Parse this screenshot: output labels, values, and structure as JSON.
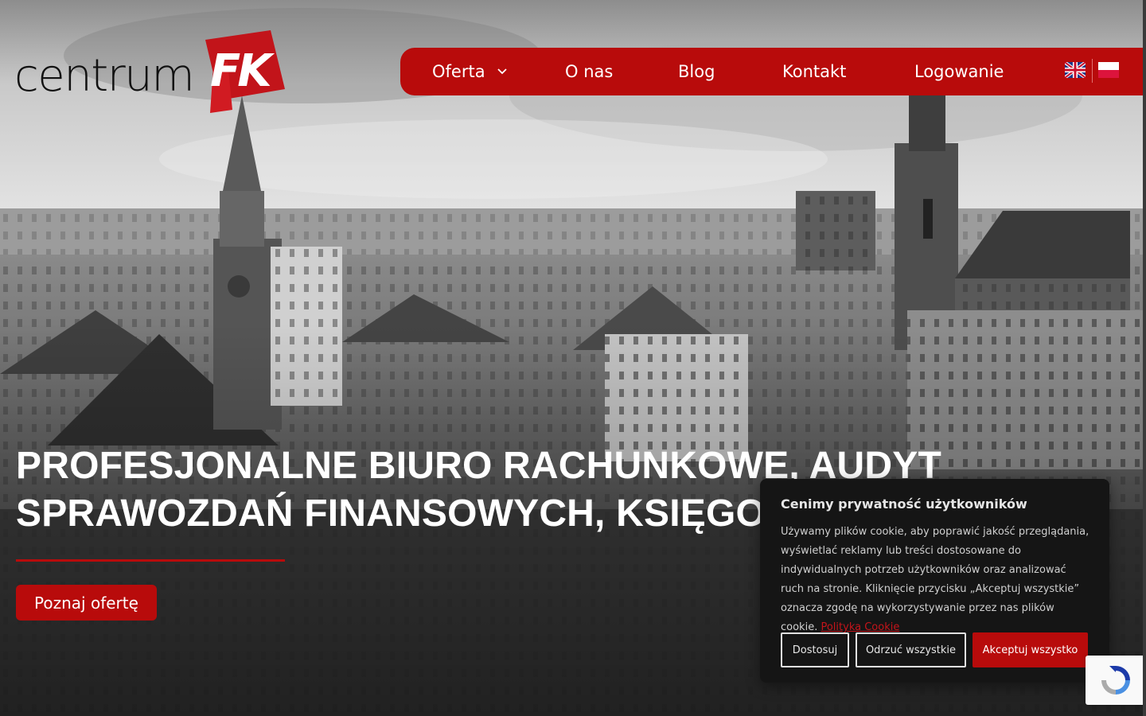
{
  "brand": {
    "logo_text": "centrum",
    "logo_mark_text": "FK",
    "accent_color": "#b80b0b"
  },
  "nav": {
    "items": [
      {
        "label": "Oferta",
        "has_dropdown": true
      },
      {
        "label": "O nas"
      },
      {
        "label": "Blog"
      },
      {
        "label": "Kontakt"
      },
      {
        "label": "Logowanie"
      }
    ],
    "languages": [
      {
        "icon": "uk-flag-icon"
      },
      {
        "icon": "pl-flag-icon"
      }
    ]
  },
  "hero": {
    "headline_line1": "PROFESJONALNE BIURO RACHUNKOWE, AUDYT",
    "headline_line2": "SPRAWOZDAŃ FINANSOWYCH, KSIĘGO",
    "cta_label": "Poznaj ofertę"
  },
  "cookie": {
    "title": "Cenimy prywatność użytkowników",
    "text": "Używamy plików cookie, aby poprawić jakość przeglądania, wyświetlać reklamy lub treści dostosowane do indywidualnych potrzeb użytkowników oraz analizować ruch na stronie. Kliknięcie przycisku „Akceptuj wszystkie” oznacza zgodę na wykorzystywanie przez nas plików cookie.",
    "link_label": "Polityka Cookie",
    "btn_customize": "Dostosuj",
    "btn_reject": "Odrzuć wszystkie",
    "btn_accept": "Akceptuj wszystko"
  },
  "recaptcha": {
    "icon": "recaptcha-icon"
  }
}
